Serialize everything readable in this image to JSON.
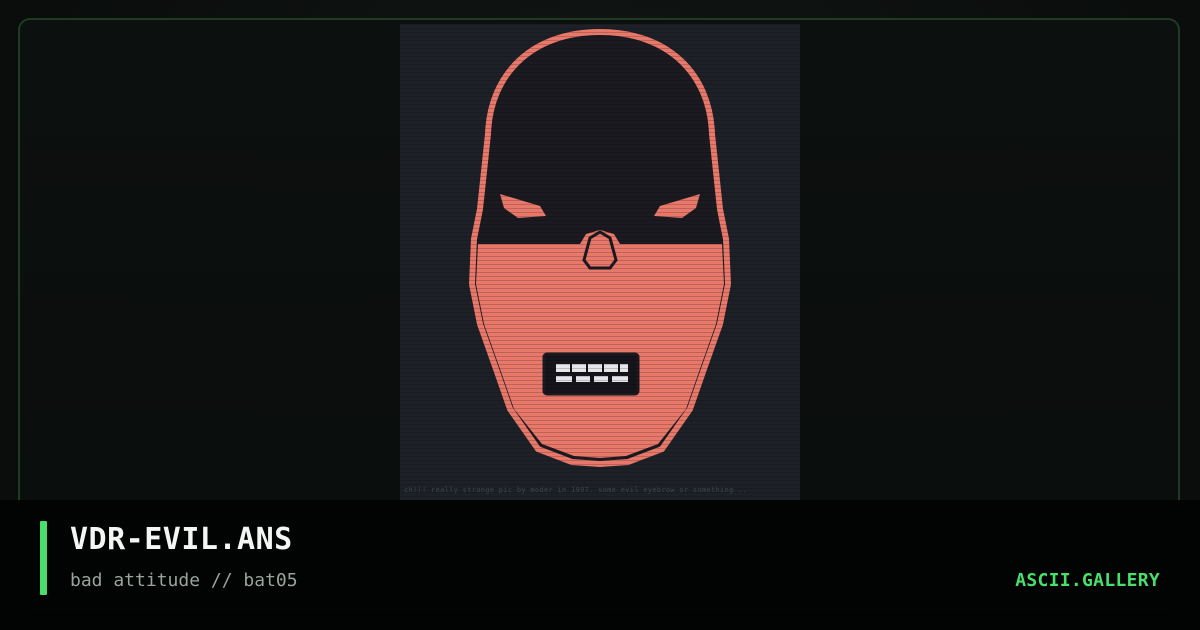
{
  "artwork": {
    "caption": "ch!!! really strange pic by moder in 1997.  some evil eyebrow or something .."
  },
  "info": {
    "title": "VDR-EVIL.ANS",
    "subtitle": "bad attitude // bat05"
  },
  "brand": {
    "label": "ASCII.GALLERY"
  },
  "colors": {
    "accent": "#4ade6a",
    "mask": "#e8786a",
    "art_background": "#1d2127"
  }
}
